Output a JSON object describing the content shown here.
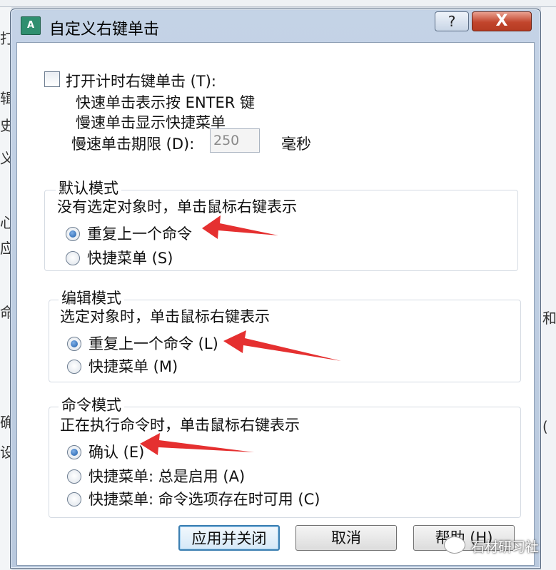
{
  "dialog": {
    "title": "自定义右键单击",
    "help_glyph": "?",
    "close_glyph": "X",
    "icon_name": "app-icon"
  },
  "timed": {
    "checkbox_label": "打开计时右键单击 (T):",
    "line1": "快速单击表示按 ENTER 键",
    "line2": "慢速单击显示快捷菜单",
    "duration_label": "慢速单击期限 (D):",
    "duration_value": "250",
    "unit": "毫秒"
  },
  "default_mode": {
    "title": "默认模式",
    "desc": "没有选定对象时，单击鼠标右键表示",
    "options": [
      "重复上一个命令",
      "快捷菜单 (S)"
    ]
  },
  "edit_mode": {
    "title": "编辑模式",
    "desc": "选定对象时，单击鼠标右键表示",
    "options": [
      "重复上一个命令 (L)",
      "快捷菜单 (M)"
    ]
  },
  "command_mode": {
    "title": "命令模式",
    "desc": "正在执行命令时，单击鼠标右键表示",
    "options": [
      "确认 (E)",
      "快捷菜单: 总是启用 (A)",
      "快捷菜单: 命令选项存在时可用 (C)"
    ]
  },
  "buttons": {
    "apply": "应用并关闭",
    "cancel": "取消",
    "help": "帮助 (H)"
  },
  "background": {
    "left_fragments": [
      "打",
      "辑",
      "史",
      "义",
      "心",
      "应",
      "命",
      "确",
      "设"
    ],
    "right_fragments": [
      "和",
      "("
    ]
  },
  "watermark": "石材研习社",
  "colors": {
    "arrow": "#e53030",
    "radio_selected": "#1f5da8",
    "close_button": "#c2452c"
  }
}
